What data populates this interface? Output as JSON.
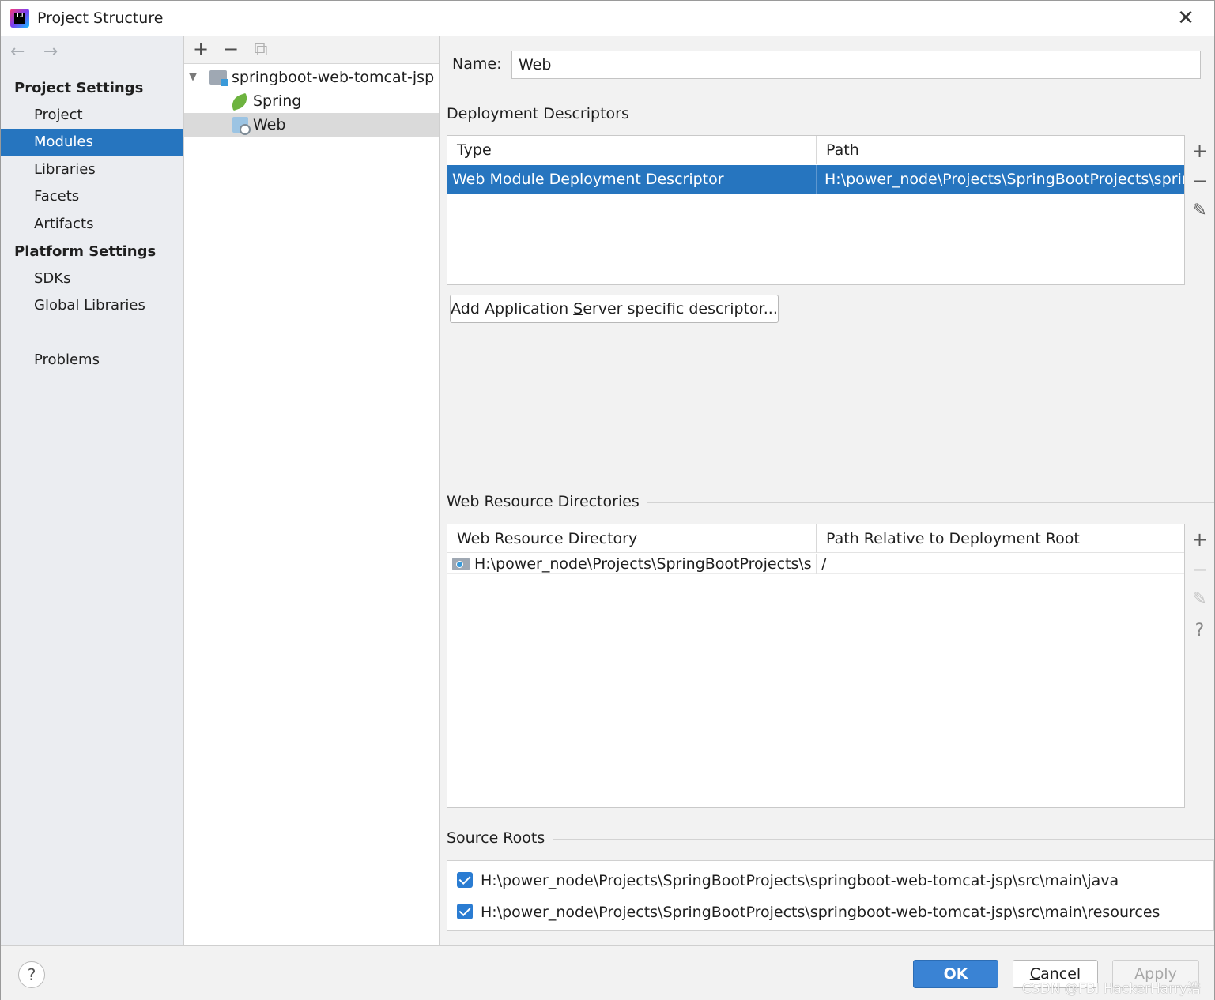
{
  "window": {
    "title": "Project Structure",
    "logo_text": "IJ"
  },
  "nav": {
    "back_icon": "←",
    "forward_icon": "→",
    "project_settings_header": "Project Settings",
    "project_items": [
      "Project",
      "Modules",
      "Libraries",
      "Facets",
      "Artifacts"
    ],
    "selected_item": "Modules",
    "platform_settings_header": "Platform Settings",
    "platform_items": [
      "SDKs",
      "Global Libraries"
    ],
    "problems": "Problems"
  },
  "tree": {
    "toolbar": {
      "add": "+",
      "remove": "−",
      "copy": "⧉"
    },
    "root": "springboot-web-tomcat-jsp",
    "children": [
      "Spring",
      "Web"
    ],
    "selected": "Web"
  },
  "facet": {
    "name_label_pre": "Na",
    "name_label_underlined": "m",
    "name_label_post": "e:",
    "name_value": "Web",
    "deployment": {
      "title": "Deployment Descriptors",
      "columns": [
        "Type",
        "Path"
      ],
      "rows": [
        {
          "type": "Web Module Deployment Descriptor",
          "path": "H:\\power_node\\Projects\\SpringBootProjects\\springboot-web-tomcat-jsp\\src\\main\\webapp\\WEB-INF\\web.xml"
        }
      ],
      "add_server_btn_pre": "Add Application ",
      "add_server_btn_underlined": "S",
      "add_server_btn_post": "erver specific descriptor..."
    },
    "web_resources": {
      "title": "Web Resource Directories",
      "columns": [
        "Web Resource Directory",
        "Path Relative to Deployment Root"
      ],
      "rows": [
        {
          "directory": "H:\\power_node\\Projects\\SpringBootProjects\\spr...",
          "relative": "/"
        }
      ]
    },
    "source_roots": {
      "title": "Source Roots",
      "items": [
        {
          "checked": true,
          "path": "H:\\power_node\\Projects\\SpringBootProjects\\springboot-web-tomcat-jsp\\src\\main\\java"
        },
        {
          "checked": true,
          "path": "H:\\power_node\\Projects\\SpringBootProjects\\springboot-web-tomcat-jsp\\src\\main\\resources"
        }
      ]
    },
    "side_tools": {
      "add": "+",
      "remove": "−",
      "edit": "✎",
      "help": "?"
    }
  },
  "footer": {
    "help": "?",
    "ok": "OK",
    "cancel_pre": "",
    "cancel_underlined": "C",
    "cancel_post": "ancel",
    "apply": "Apply"
  },
  "watermark": "CSDN @FBI HackerHarry浩",
  "colors": {
    "selection": "#2675bf",
    "ok_button": "#3a83d4",
    "nav_background": "#ebedf1"
  }
}
